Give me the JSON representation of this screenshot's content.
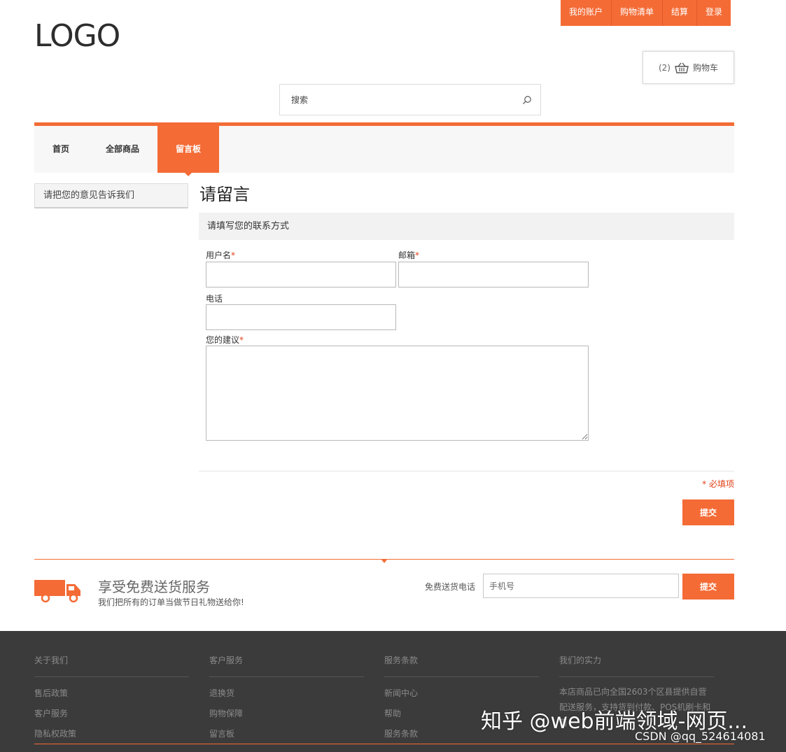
{
  "header": {
    "logo": "LOGO",
    "top_nav": [
      "我的账户",
      "购物清单",
      "结算",
      "登录"
    ],
    "cart": {
      "count": "(2)",
      "label": "购物车"
    },
    "search": {
      "placeholder": "搜索"
    }
  },
  "main_nav": {
    "items": [
      {
        "label": "首页",
        "active": false
      },
      {
        "label": "全部商品",
        "active": false
      },
      {
        "label": "留言板",
        "active": true
      }
    ]
  },
  "sidebar": {
    "title": "请把您的意见告诉我们"
  },
  "form": {
    "title": "请留言",
    "section": "请填写您的联系方式",
    "username_label": "用户名",
    "email_label": "邮箱",
    "phone_label": "电话",
    "suggestion_label": "您的建议",
    "required_marker": "*",
    "required_note": "* 必填项",
    "submit": "提交"
  },
  "delivery": {
    "title": "享受免费送货服务",
    "subtitle": "我们把所有的订单当做节日礼物送给你!",
    "phone_label": "免费送货电话",
    "phone_placeholder": "手机号",
    "submit": "提交"
  },
  "footer": {
    "columns": [
      {
        "heading": "关于我们",
        "links": [
          "售后政策",
          "客户服务",
          "隐私权政策"
        ]
      },
      {
        "heading": "客户服务",
        "links": [
          "退换货",
          "购物保障",
          "留言板"
        ]
      },
      {
        "heading": "服务条款",
        "links": [
          "新闻中心",
          "帮助",
          "服务条款"
        ]
      },
      {
        "heading": "我们的实力",
        "text": "本店商品已向全国2603个区县提供自营配送服务，支持货到付款、POS机刷卡和售"
      }
    ]
  },
  "watermark": {
    "main": "知乎 @web前端领域-网页...",
    "sub": "CSDN @qq_524614081"
  },
  "colors": {
    "accent": "#f46b35",
    "footer_bg": "#3b3b3b"
  }
}
